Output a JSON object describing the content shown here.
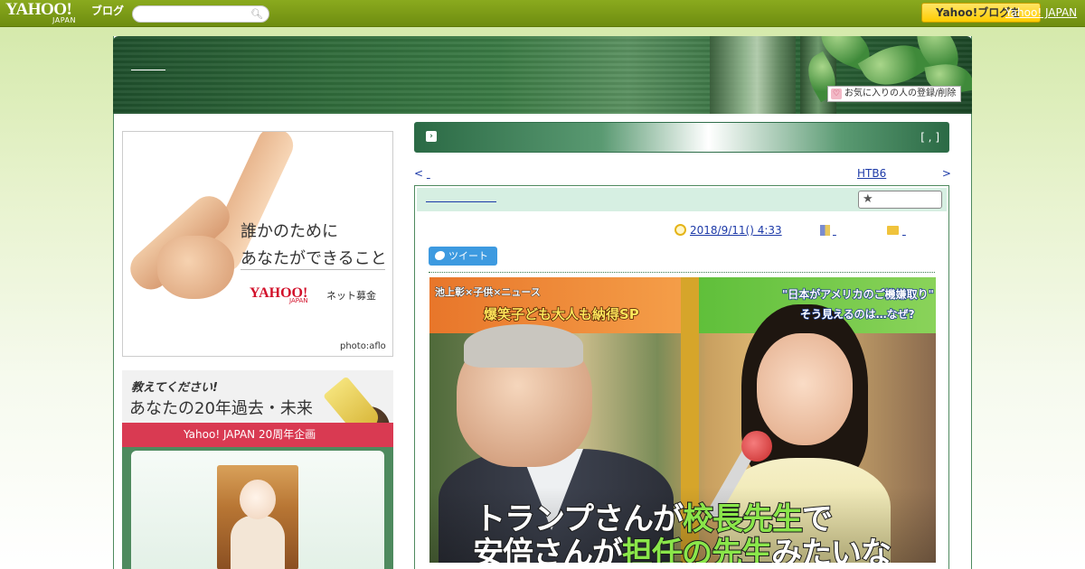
{
  "topbar": {
    "logo": "YAHOO!",
    "logo_sub": "JAPAN",
    "blog_label": "ブログ",
    "search_placeholder": "",
    "yj_button": "Yahoo!ブログを",
    "yj_link": "Yahoo! JAPAN"
  },
  "banner": {
    "fav_label": "お気に入りの人の登録/削除"
  },
  "ads": {
    "ad1_line1": "誰かのために",
    "ad1_line2": "あなたができること",
    "ad1_logo": "YAHOO!",
    "ad1_logo_sub": "JAPAN",
    "ad1_net": "ネット募金",
    "ad1_credit": "photo:aflo",
    "ad2_line1": "教えてください!",
    "ad2_line2": "あなたの20年過去・未来",
    "ad2_bar": "Yahoo! JAPAN 20周年企画"
  },
  "article": {
    "title_bar_right": "[ , ]",
    "nav_prev_arrow": "<",
    "nav_next_label": "HTB6",
    "nav_next_arrow": ">",
    "date": "2018/9/11()  4:33",
    "tweet_label": "ツイート",
    "photo_caption_1a": "トランプさんが",
    "photo_caption_1b": "校長先生",
    "photo_caption_1c": "で",
    "photo_caption_2a": "安倍さんが",
    "photo_caption_2b": "担任の先生",
    "photo_caption_2c": "みたいな",
    "photo_tag_left": "池上彰×子供×ニュース",
    "photo_tag_left2": "爆笑子ども大人も納得SP",
    "photo_tag_right": "\"日本がアメリカのご機嫌取り\"",
    "photo_tag_right2": "そう見えるのは…なぜ?"
  },
  "colors": {
    "topbar": "#7b9a16",
    "frame_border": "#4f8a5f",
    "article_head": "#d6efe2",
    "link": "#1d3aa8",
    "tweet": "#3d9ae0"
  },
  "icons": [
    "search-icon",
    "favorite-icon",
    "post-icon",
    "star-icon",
    "clock-icon",
    "book-icon",
    "folder-icon",
    "bird-icon"
  ]
}
